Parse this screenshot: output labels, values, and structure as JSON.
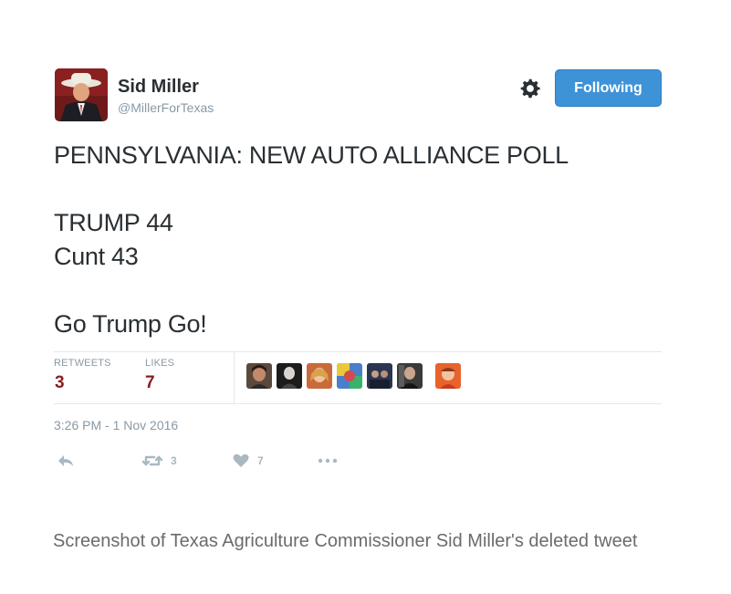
{
  "header": {
    "name": "Sid Miller",
    "handle": "@MillerForTexas",
    "follow_label": "Following",
    "settings_icon": "gear-icon"
  },
  "tweet": {
    "lines": [
      "PENNSYLVANIA: NEW AUTO ALLIANCE POLL",
      "TRUMP 44",
      "Cunt 43",
      "Go Trump Go!"
    ]
  },
  "stats": {
    "retweets_label": "RETWEETS",
    "retweets": "3",
    "likes_label": "LIKES",
    "likes": "7",
    "liker_avatar_count_shown": 7
  },
  "timestamp": "3:26 PM - 1 Nov 2016",
  "actions": {
    "reply_icon": "reply-icon",
    "retweet_icon": "retweet-icon",
    "retweet_count": "3",
    "like_icon": "heart-icon",
    "like_count": "7",
    "more_icon": "more-icon"
  },
  "caption": "Screenshot of Texas Agriculture Commissioner Sid Miller's deleted tweet",
  "colors": {
    "follow_button": "#3e92d8",
    "stat_value": "#8b1d1d",
    "muted": "#8899a6"
  }
}
